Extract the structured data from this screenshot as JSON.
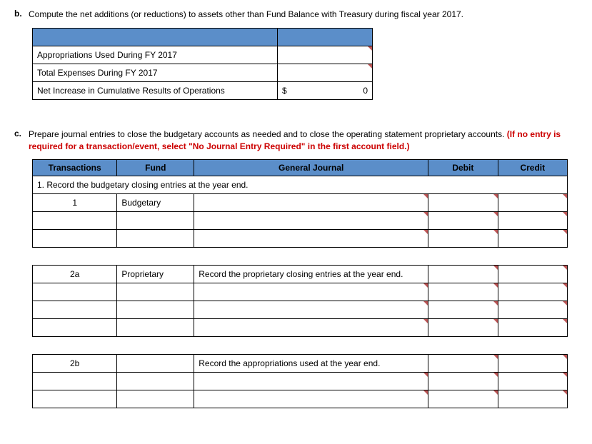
{
  "section_b": {
    "label": "b.",
    "text": "Compute the net additions (or reductions) to assets other than Fund Balance with Treasury during fiscal year 2017.",
    "rows": {
      "r1": "Appropriations Used During FY 2017",
      "r2": "Total Expenses During FY 2017",
      "r3": "Net Increase in Cumulative Results of Operations",
      "r3_sym": "$",
      "r3_val": "0"
    }
  },
  "section_c": {
    "label": "c.",
    "text_black": "Prepare journal entries to close the budgetary accounts as needed and to close the operating statement proprietary accounts. ",
    "text_red": "(If no entry is required for a transaction/event, select \"No Journal Entry Required\" in the first account field.)",
    "headers": {
      "trans": "Transactions",
      "fund": "Fund",
      "gj": "General Journal",
      "debit": "Debit",
      "credit": "Credit"
    },
    "instruction1": "1. Record the budgetary closing entries at the year end.",
    "row1": {
      "trans": "1",
      "fund": "Budgetary"
    },
    "row2a": {
      "trans": "2a",
      "fund": "Proprietary",
      "gj": "Record the proprietary closing entries at the year end."
    },
    "row2b": {
      "trans": "2b",
      "gj": "Record the appropriations used at the year end."
    }
  }
}
